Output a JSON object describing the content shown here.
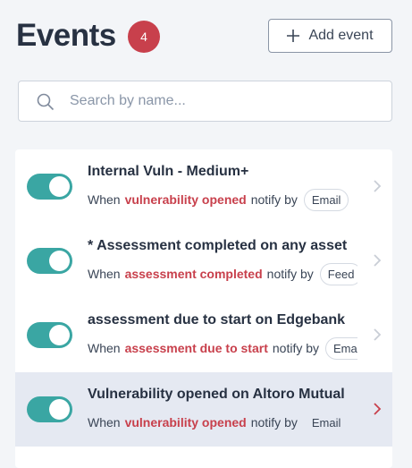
{
  "header": {
    "title": "Events",
    "count": "4",
    "add_label": "Add event"
  },
  "search": {
    "placeholder": "Search by name...",
    "value": ""
  },
  "events": [
    {
      "title": "Internal Vuln - Medium+",
      "when": "When",
      "event": "vulnerability opened",
      "notify": "notify by",
      "channel": "Email",
      "enabled": true
    },
    {
      "title": "* Assessment completed on any asset",
      "when": "When",
      "event": "assessment completed",
      "notify": "notify by",
      "channel": "Feed",
      "enabled": true
    },
    {
      "title": "assessment due to start on Edgebank",
      "when": "When",
      "event": "assessment due to start",
      "notify": "notify by",
      "channel": "Email",
      "enabled": true
    },
    {
      "title": "Vulnerability opened on Altoro Mutual",
      "when": "When",
      "event": "vulnerability opened",
      "notify": "notify by",
      "channel": "Email",
      "enabled": true,
      "selected": true
    }
  ],
  "colors": {
    "accent": "#c8404c",
    "toggle_on": "#3aa6a3",
    "selected_row": "#e5e9f2"
  },
  "icons": [
    "plus-icon",
    "search-icon",
    "chevron-right-icon"
  ]
}
